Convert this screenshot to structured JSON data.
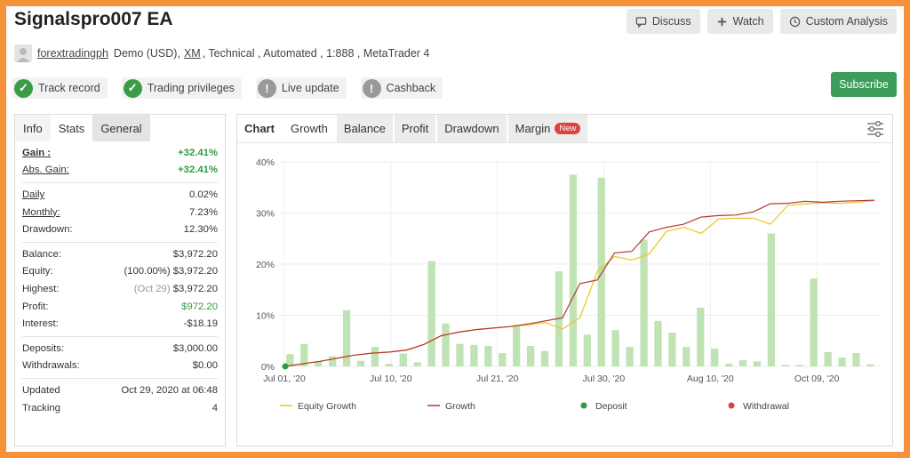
{
  "header": {
    "title": "Signalspro007 EA",
    "buttons": {
      "discuss": "Discuss",
      "watch": "Watch",
      "custom_analysis": "Custom Analysis"
    }
  },
  "account": {
    "user": "forextradingph",
    "type": "Demo (USD),",
    "broker": "XM",
    "details": ", Technical , Automated , 1:888 , MetaTrader 4"
  },
  "badges": [
    {
      "label": "Track record",
      "status": "ok"
    },
    {
      "label": "Trading privileges",
      "status": "ok"
    },
    {
      "label": "Live update",
      "status": "warn"
    },
    {
      "label": "Cashback",
      "status": "warn"
    }
  ],
  "subscribe_label": "Subscribe",
  "left_tabs": [
    "Info",
    "Stats",
    "General"
  ],
  "stats": {
    "gain_label": "Gain :",
    "gain": "+32.41%",
    "abs_gain_label": "Abs. Gain:",
    "abs_gain": "+32.41%",
    "daily_label": "Daily",
    "daily": "0.02%",
    "monthly_label": "Monthly:",
    "monthly": "7.23%",
    "drawdown_label": "Drawdown:",
    "drawdown": "12.30%",
    "balance_label": "Balance:",
    "balance": "$3,972.20",
    "equity_label": "Equity:",
    "equity": "(100.00%) $3,972.20",
    "highest_label": "Highest:",
    "highest_note": "(Oct 29)",
    "highest": "$3,972.20",
    "profit_label": "Profit:",
    "profit": "$972.20",
    "interest_label": "Interest:",
    "interest": "-$18.19",
    "deposits_label": "Deposits:",
    "deposits": "$3,000.00",
    "withdrawals_label": "Withdrawals:",
    "withdrawals": "$0.00",
    "updated_label": "Updated",
    "updated": "Oct 29, 2020 at 06:48",
    "tracking_label": "Tracking",
    "tracking": "4"
  },
  "chart_tabs": {
    "chart": "Chart",
    "growth": "Growth",
    "balance": "Balance",
    "profit": "Profit",
    "drawdown": "Drawdown",
    "margin": "Margin",
    "new_tag": "New"
  },
  "colors": {
    "equity": "#e8c51e",
    "growth": "#b5382f",
    "bars": "#bfe3b3",
    "deposit": "#2e9d3e",
    "withdrawal": "#d9433f"
  },
  "chart_data": {
    "type": "line",
    "x_ticks": [
      "Jul 01, '20",
      "Jul 10, '20",
      "Jul 21, '20",
      "Jul 30, '20",
      "Aug 10, '20",
      "Oct 09, '20"
    ],
    "y_ticks": [
      "0%",
      "10%",
      "20%",
      "30%",
      "40%"
    ],
    "ylim": [
      0,
      40
    ],
    "legend": [
      "Equity Growth",
      "Growth",
      "Deposit",
      "Withdrawal"
    ],
    "bars": [
      2.4,
      4.4,
      1.0,
      2.0,
      11.0,
      1.1,
      3.8,
      0.5,
      2.5,
      0.8,
      20.6,
      8.4,
      4.4,
      4.2,
      4.0,
      2.6,
      8.1,
      4.0,
      3.0,
      18.6,
      37.5,
      6.2,
      36.9,
      7.1,
      3.8,
      24.8,
      8.9,
      6.6,
      3.8,
      11.5,
      3.5,
      0.5,
      1.2,
      1.0,
      26.0,
      0.3,
      0.3,
      17.2,
      2.8,
      1.7,
      2.6,
      0.4
    ],
    "series": [
      {
        "name": "Equity Growth",
        "values": [
          0,
          0.5,
          1.0,
          1.6,
          2.2,
          2.6,
          2.8,
          3.2,
          4.3,
          6.0,
          6.7,
          7.2,
          7.5,
          7.8,
          8.1,
          8.6,
          7.3,
          9.5,
          18.5,
          21.5,
          20.8,
          22.0,
          26.4,
          27.2,
          26.0,
          28.8,
          29.0,
          29.0,
          27.8,
          31.5,
          31.8,
          32.0,
          31.9,
          32.1,
          32.4
        ]
      },
      {
        "name": "Growth",
        "values": [
          0,
          0.5,
          1.0,
          1.6,
          2.2,
          2.6,
          2.8,
          3.2,
          4.3,
          6.0,
          6.7,
          7.2,
          7.5,
          7.8,
          8.3,
          8.9,
          9.5,
          16.2,
          16.9,
          22.2,
          22.5,
          26.3,
          27.2,
          27.8,
          29.2,
          29.5,
          29.6,
          30.2,
          31.8,
          31.9,
          32.3,
          32.1,
          32.3,
          32.4,
          32.5
        ]
      }
    ],
    "deposits": [
      0
    ],
    "withdrawals": []
  }
}
